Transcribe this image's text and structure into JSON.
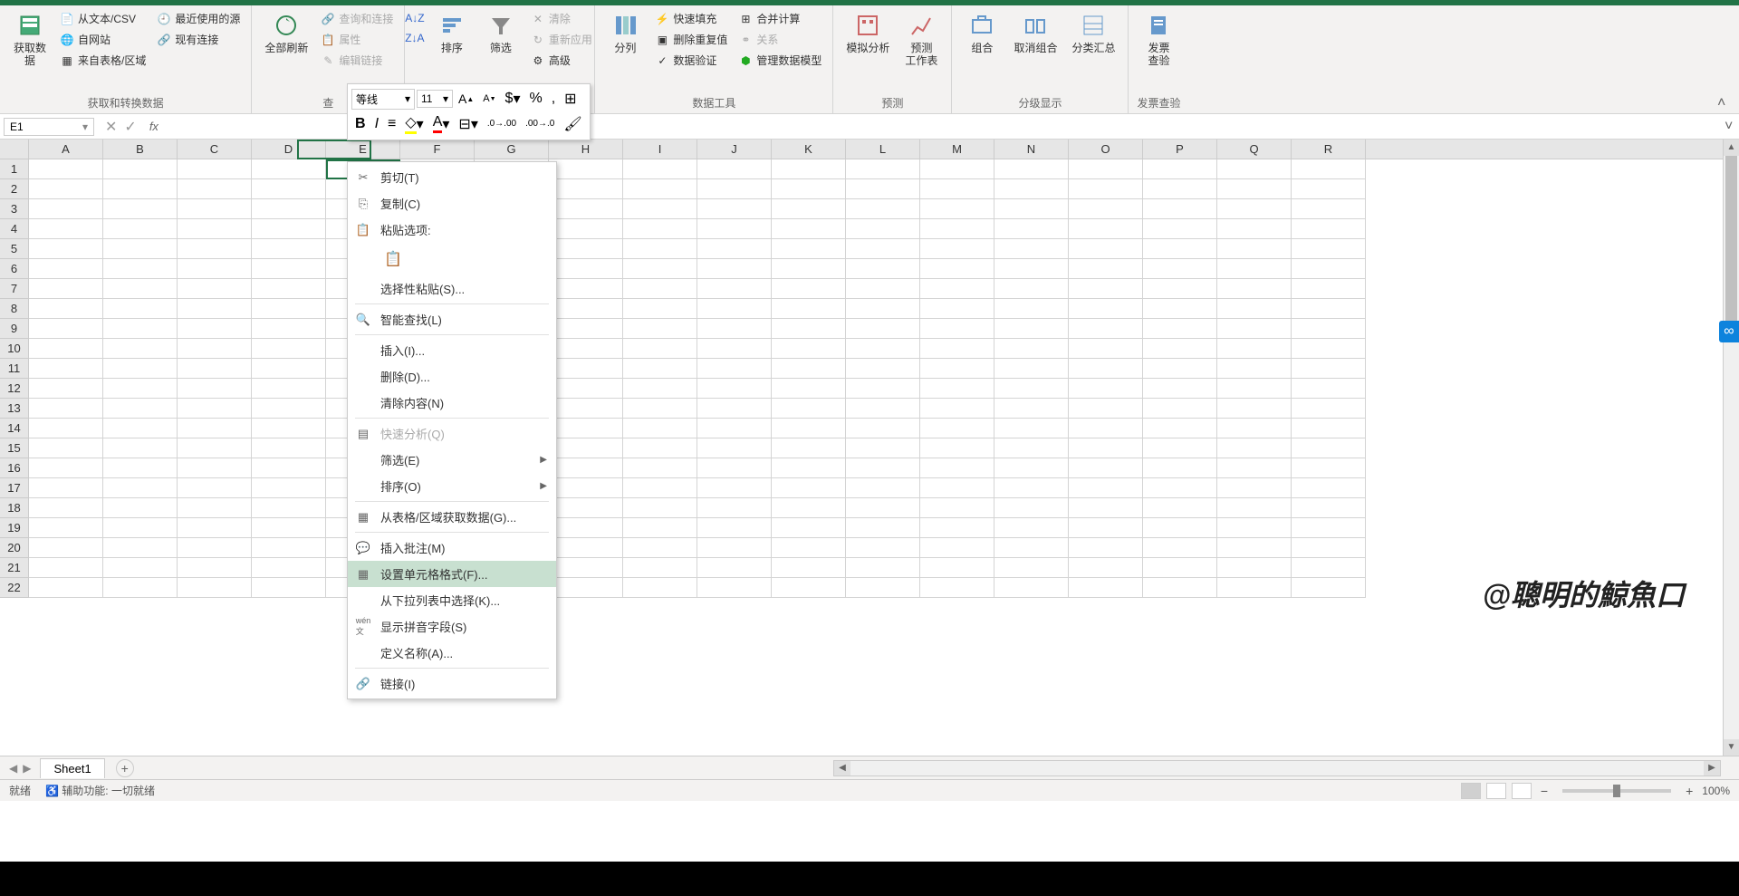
{
  "ribbon": {
    "groups": {
      "get_transform": {
        "label": "获取和转换数据",
        "get_data": "获取数\n据",
        "from_text_csv": "从文本/CSV",
        "from_web": "自网站",
        "from_table": "来自表格/区域",
        "recent_sources": "最近使用的源",
        "existing_conn": "现有连接"
      },
      "queries": {
        "label": "查",
        "refresh_all": "全部刷新",
        "queries_conn": "查询和连接",
        "properties": "属性",
        "edit_links": "编辑链接"
      },
      "sort_filter": {
        "sort": "排序",
        "filter": "筛选",
        "clear": "清除",
        "reapply": "重新应用",
        "advanced": "高级"
      },
      "data_tools": {
        "label": "数据工具",
        "text_to_cols": "分列",
        "flash_fill": "快速填充",
        "remove_dup": "删除重复值",
        "data_validation": "数据验证",
        "consolidate": "合并计算",
        "relationships": "关系",
        "data_model": "管理数据模型"
      },
      "forecast": {
        "label": "预测",
        "whatif": "模拟分析",
        "forecast_sheet": "预测\n工作表"
      },
      "outline": {
        "label": "分级显示",
        "group": "组合",
        "ungroup": "取消组合",
        "subtotal": "分类汇总"
      },
      "invoice": {
        "label": "发票查验",
        "invoice_check": "发票\n查验"
      }
    }
  },
  "mini_toolbar": {
    "font_name": "等线",
    "font_size": "11"
  },
  "name_box": "E1",
  "columns": [
    "A",
    "B",
    "C",
    "D",
    "E",
    "F",
    "G",
    "H",
    "I",
    "J",
    "K",
    "L",
    "M",
    "N",
    "O",
    "P",
    "Q",
    "R"
  ],
  "rows": [
    "1",
    "2",
    "3",
    "4",
    "5",
    "6",
    "7",
    "8",
    "9",
    "10",
    "11",
    "12",
    "13",
    "14",
    "15",
    "16",
    "17",
    "18",
    "19",
    "20",
    "21",
    "22"
  ],
  "context_menu": {
    "cut": "剪切(T)",
    "copy": "复制(C)",
    "paste_options": "粘贴选项:",
    "paste_special": "选择性粘贴(S)...",
    "smart_lookup": "智能查找(L)",
    "insert": "插入(I)...",
    "delete": "删除(D)...",
    "clear": "清除内容(N)",
    "quick_analysis": "快速分析(Q)",
    "filter": "筛选(E)",
    "sort": "排序(O)",
    "get_data_table": "从表格/区域获取数据(G)...",
    "insert_comment": "插入批注(M)",
    "format_cells": "设置单元格格式(F)...",
    "pick_from_list": "从下拉列表中选择(K)...",
    "show_pinyin": "显示拼音字段(S)",
    "define_name": "定义名称(A)...",
    "link": "链接(I)"
  },
  "sheet_tabs": {
    "sheet1": "Sheet1"
  },
  "status_bar": {
    "ready": "就绪",
    "accessibility": "辅助功能: 一切就绪",
    "zoom": "100%"
  },
  "watermark": "@聰明的鯨魚口"
}
